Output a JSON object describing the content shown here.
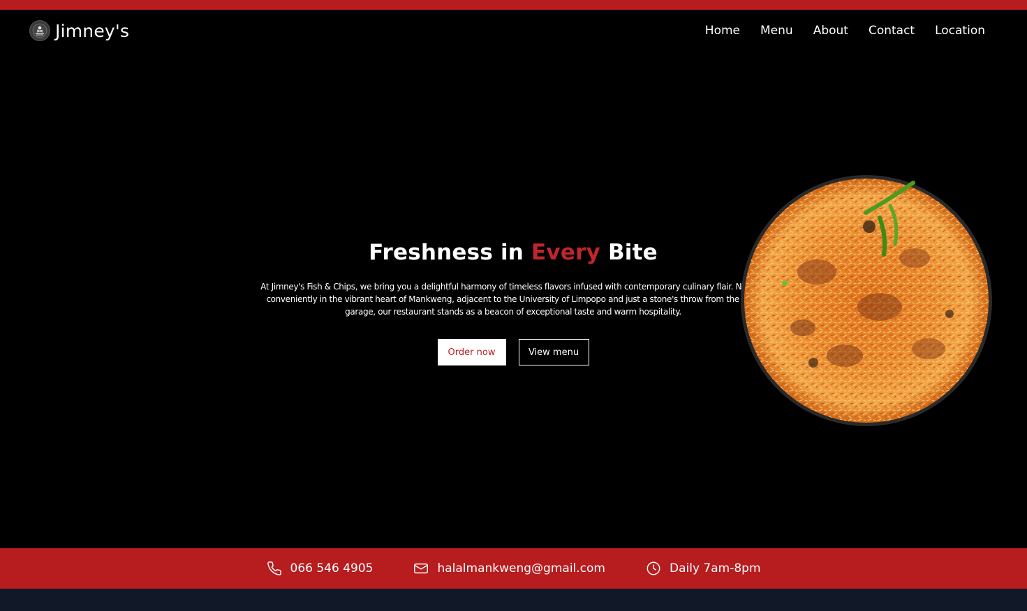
{
  "brand": {
    "name": "Jimney's",
    "logo_icon": "halal-food-logo-icon"
  },
  "nav": {
    "items": [
      {
        "label": "Home"
      },
      {
        "label": "Menu"
      },
      {
        "label": "About"
      },
      {
        "label": "Contact"
      },
      {
        "label": "Location"
      }
    ]
  },
  "hero": {
    "title_start": "Freshness in ",
    "title_accent": "Every",
    "title_end": " Bite",
    "description": "At Jimney's Fish & Chips, we bring you a delightful harmony of timeless flavors infused with contemporary culinary flair. Nestled conveniently in the vibrant heart of Mankweng, adjacent to the University of Limpopo and just a stone's throw from the local garage, our restaurant stands as a beacon of exceptional taste and warm hospitality.",
    "order_button": "Order now",
    "menu_button": "View menu",
    "image_icon": "biryani-dish-image"
  },
  "contact": {
    "phone": "066 546 4905",
    "email": "halalmankweng@gmail.com",
    "hours": "Daily 7am-8pm"
  },
  "colors": {
    "accent": "#b71c1f",
    "background": "#000000",
    "footer_band": "#111827"
  }
}
